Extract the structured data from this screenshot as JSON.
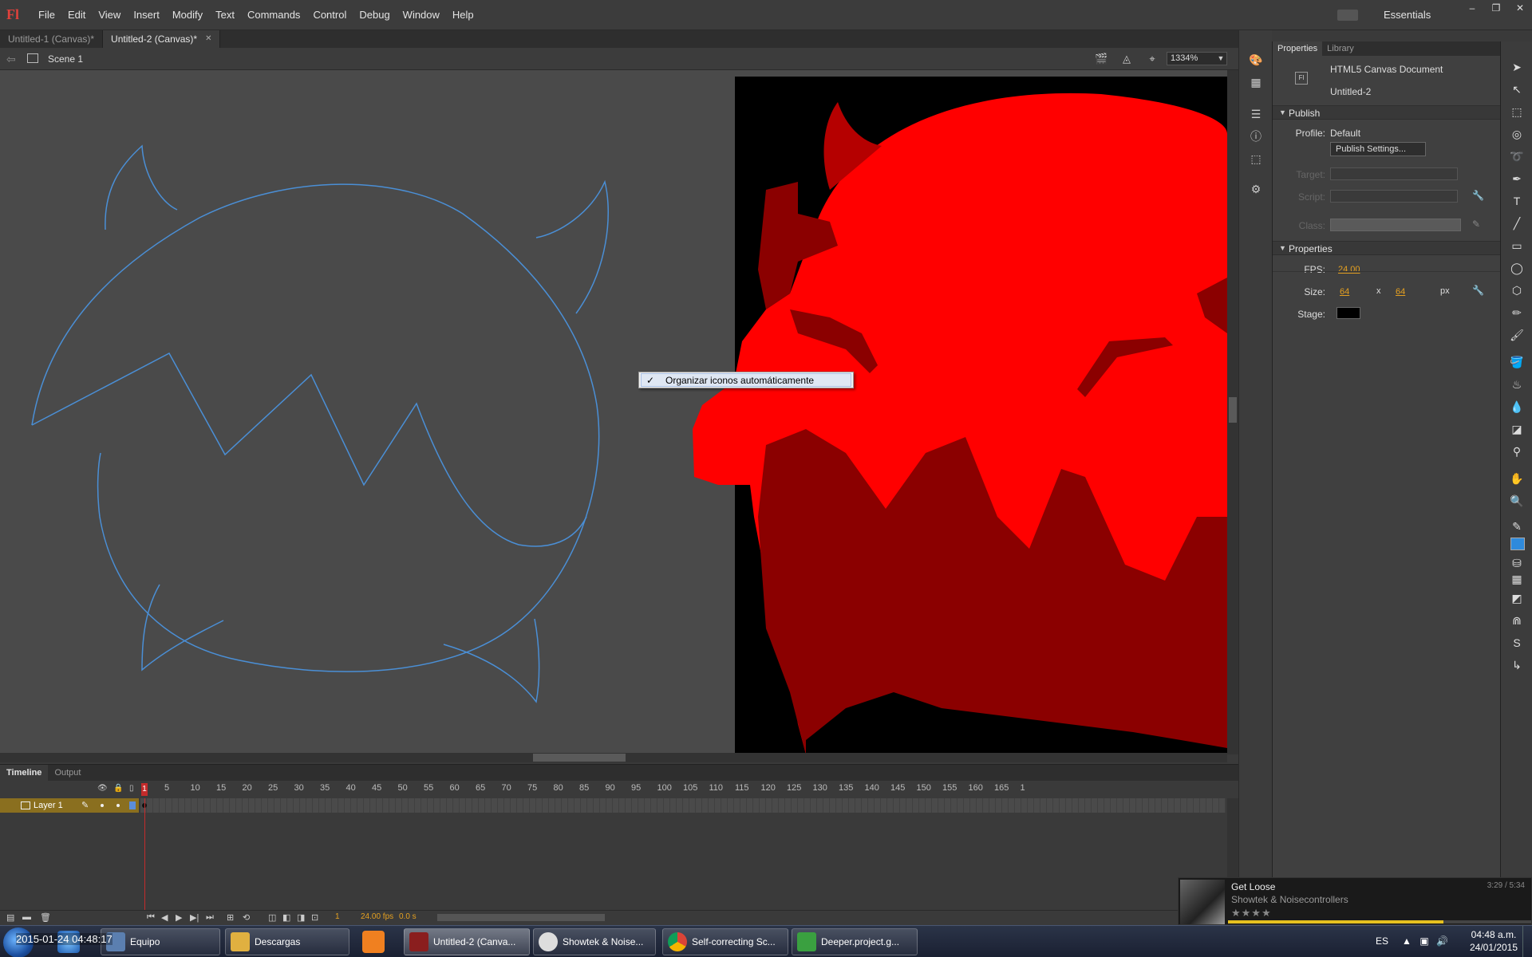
{
  "app": {
    "logo": "Fl",
    "menu": [
      "File",
      "Edit",
      "View",
      "Insert",
      "Modify",
      "Text",
      "Commands",
      "Control",
      "Debug",
      "Window",
      "Help"
    ],
    "workspace": "Essentials",
    "window_controls": [
      "–",
      "❐",
      "✕"
    ]
  },
  "doc_tabs": [
    {
      "label": "Untitled-1 (Canvas)*",
      "active": false
    },
    {
      "label": "Untitled-2 (Canvas)*",
      "active": true
    }
  ],
  "editbar": {
    "scene": "Scene 1",
    "zoom": "1334%"
  },
  "context_menu": {
    "check": "✓",
    "item": "Organizar iconos automáticamente"
  },
  "timeline": {
    "tabs": [
      "Timeline",
      "Output"
    ],
    "ruler": [
      "5",
      "10",
      "15",
      "20",
      "25",
      "30",
      "35",
      "40",
      "45",
      "50",
      "55",
      "60",
      "65",
      "70",
      "75",
      "80",
      "85",
      "90",
      "95",
      "100",
      "105",
      "110",
      "115",
      "120",
      "125",
      "130",
      "135",
      "140",
      "145",
      "150",
      "155",
      "160",
      "165",
      "1"
    ],
    "playhead": "1",
    "layer_name": "Layer 1",
    "current_frame": "1",
    "fps": "24.00 fps",
    "time": "0.0 s"
  },
  "properties": {
    "tabs": [
      "Properties",
      "Library"
    ],
    "doc_type": "HTML5 Canvas Document",
    "doc_name": "Untitled-2",
    "doc_icon": "Fl",
    "publish_section": "Publish",
    "profile_label": "Profile:",
    "profile_value": "Default",
    "publish_settings": "Publish Settings...",
    "target_label": "Target:",
    "script_label": "Script:",
    "class_label": "Class:",
    "properties_section": "Properties",
    "fps_label": "FPS:",
    "fps_value": "24.00",
    "size_label": "Size:",
    "width": "64",
    "x": "x",
    "height": "64",
    "unit": "px",
    "stage_label": "Stage:",
    "stage_color": "#000000"
  },
  "music": {
    "title": "Get Loose",
    "artist": "Showtek & Noisecontrollers",
    "stars": "★★★★",
    "time": "3:29 / 5:34",
    "progress": 0.71
  },
  "taskbar": {
    "buttons": [
      "Equipo",
      "Descargas",
      "Untitled-2 (Canva...",
      "Showtek & Noise...",
      "Self-correcting Sc...",
      "Deeper.project.g..."
    ],
    "lang": "ES",
    "clock_time": "04:48 a.m.",
    "clock_date": "24/01/2015",
    "overlay": "2015-01-24 04:48:17"
  },
  "colors": {
    "accent_orange": "#e5a020",
    "outline_blue": "#4a8fd6",
    "sprite_red": "#ff0000",
    "sprite_dark": "#8b0000"
  }
}
